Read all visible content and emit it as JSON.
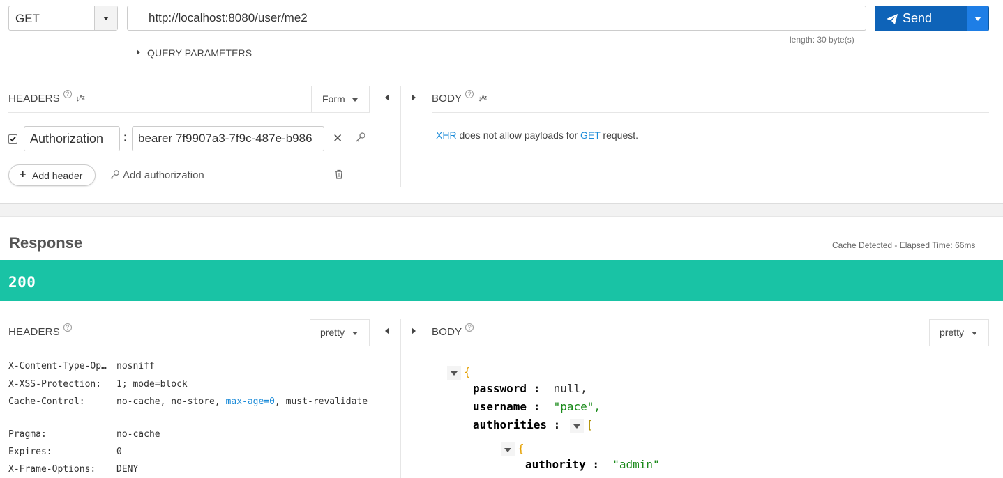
{
  "request": {
    "method": "GET",
    "url": "http://localhost:8080/user/me2",
    "url_length": "length: 30 byte(s)",
    "send_label": "Send",
    "query_params_label": "QUERY PARAMETERS"
  },
  "request_headers": {
    "title": "HEADERS",
    "view_mode": "Form",
    "rows": [
      {
        "enabled": true,
        "name": "Authorization",
        "value": "bearer 7f9907a3-7f9c-487e-b986"
      }
    ],
    "add_header_label": "Add header",
    "add_auth_label": "Add authorization"
  },
  "request_body": {
    "title": "BODY",
    "note_link1": "XHR",
    "note_mid": " does not allow payloads for ",
    "note_link2": "GET",
    "note_end": " request."
  },
  "response": {
    "title": "Response",
    "elapsed": "Cache Detected - Elapsed Time: 66ms",
    "status_code": "200",
    "headers_title": "HEADERS",
    "headers_view": "pretty",
    "body_title": "BODY",
    "body_view": "pretty",
    "headers": [
      {
        "key": "X-Content-Type-Op…",
        "value": "nosniff"
      },
      {
        "key": "X-XSS-Protection:",
        "value": "1; mode=block"
      },
      {
        "key": "Cache-Control:",
        "value_a": "no-cache, no-store, ",
        "value_hl": "max-age=0",
        "value_b": ", must-revalidate"
      },
      {
        "key": "Pragma:",
        "value": "no-cache"
      },
      {
        "key": "Expires:",
        "value": "0"
      },
      {
        "key": "X-Frame-Options:",
        "value": "DENY"
      }
    ],
    "body": {
      "password_key": "password",
      "password_val": "null,",
      "username_key": "username",
      "username_val": "\"pace\",",
      "authorities_key": "authorities",
      "authority_key": "authority",
      "authority_val": "\"admin\""
    }
  },
  "colors": {
    "status_ok": "#19c3a5",
    "send_button": "#0e63b8",
    "link": "#1c8bd8"
  }
}
